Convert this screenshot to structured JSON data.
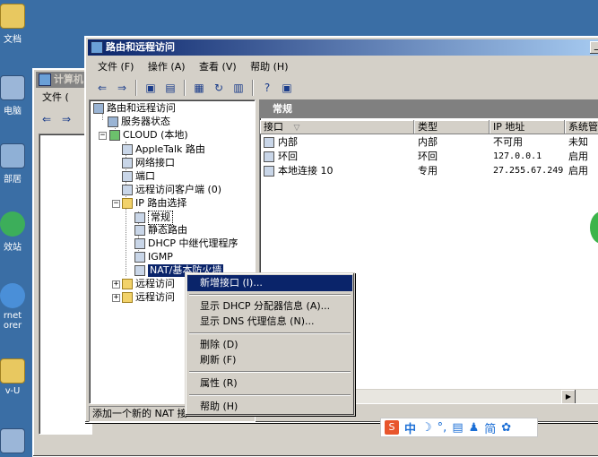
{
  "desktop": {
    "icons": [
      {
        "label": "文档"
      },
      {
        "label": "电脑"
      },
      {
        "label": "部居"
      },
      {
        "label": "效站"
      },
      {
        "label": "rnet\norer"
      },
      {
        "label": "v-U"
      }
    ]
  },
  "back_window": {
    "title": "计算机",
    "menu_file": "文件 ("
  },
  "main_window": {
    "title": "路由和远程访问",
    "menu": [
      "文件 (F)",
      "操作 (A)",
      "查看 (V)",
      "帮助 (H)"
    ],
    "tree": {
      "root": "路由和远程访问",
      "server_status": "服务器状态",
      "cloud": "CLOUD (本地)",
      "appletalk": "AppleTalk 路由",
      "network_interfaces": "网络接口",
      "ports": "端口",
      "remote_clients": "远程访问客户端 (0)",
      "ip_routing": "IP 路由选择",
      "general": "常规",
      "static_routes": "静态路由",
      "dhcp_relay": "DHCP 中继代理程序",
      "igmp": "IGMP",
      "nat": "NAT/基本防火墙",
      "remote_policy": "远程访问",
      "remote_log": "远程访问"
    },
    "right_header": "常规",
    "columns": [
      "接口",
      "类型",
      "IP 地址",
      "系统管"
    ],
    "rows": [
      {
        "name": "内部",
        "type": "内部",
        "ip": "不可用",
        "status": "未知"
      },
      {
        "name": "环回",
        "type": "环回",
        "ip": "127.0.0.1",
        "status": "启用"
      },
      {
        "name": "本地连接 10",
        "type": "专用",
        "ip": "27.255.67.249",
        "status": "启用"
      }
    ],
    "status_text": "添加一个新的 NAT 接"
  },
  "context_menu": {
    "items": [
      {
        "label": "新增接口 (I)...",
        "highlighted": true
      },
      {
        "label": "显示 DHCP 分配器信息 (A)..."
      },
      {
        "label": "显示 DNS 代理信息 (N)..."
      },
      {
        "label": "删除 (D)"
      },
      {
        "label": "刷新 (F)"
      },
      {
        "label": "属性 (R)"
      },
      {
        "label": "帮助 (H)"
      }
    ]
  },
  "ime": {
    "mode": "中",
    "simplified": "简"
  },
  "colors": {
    "desktop": "#3a6ea5",
    "titlebar_active": "#0a246a",
    "selection": "#0a246a",
    "window_face": "#d4d0c8"
  }
}
